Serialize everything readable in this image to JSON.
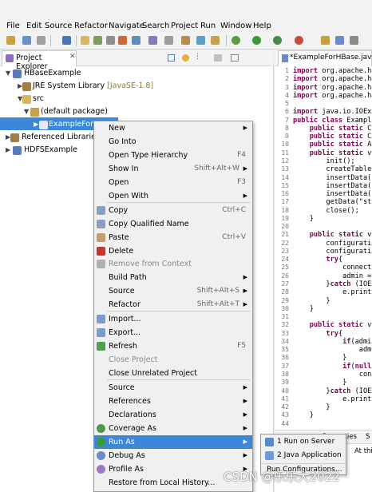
{
  "menubar": {
    "items": [
      "File",
      "Edit",
      "Source",
      "Refactor",
      "Navigate",
      "Search",
      "Project",
      "Run",
      "Window",
      "Help"
    ]
  },
  "explorer": {
    "tab_label": "Project Explorer",
    "tree": [
      {
        "label": "HBaseExample",
        "suffix": ""
      },
      {
        "label": "JRE System Library",
        "suffix": "[JavaSE-1.8]"
      },
      {
        "label": "src",
        "suffix": ""
      },
      {
        "label": "(default package)",
        "suffix": ""
      },
      {
        "label": "ExampleForHB",
        "suffix": ""
      },
      {
        "label": "Referenced Libraries",
        "suffix": ""
      },
      {
        "label": "HDFSExample",
        "suffix": ""
      }
    ]
  },
  "editor": {
    "tab_label": "*ExampleForHBase.java",
    "line_numbers": [
      "1",
      "2",
      "3",
      "4",
      "5",
      "6",
      "7",
      "8",
      "9",
      "10",
      "11",
      "12",
      "13",
      "14",
      "15",
      "16",
      "17",
      "18",
      "19",
      "20",
      "21",
      "22",
      "23",
      "24",
      "25",
      "26",
      "27",
      "28",
      "29",
      "30",
      "31",
      "32",
      "33",
      "34",
      "35",
      "36",
      "37",
      "38",
      "39",
      "40",
      "41",
      "42",
      "43",
      "44"
    ],
    "lines": [
      "import org.apache.had",
      "import org.apache.had",
      "import org.apache.had",
      "import org.apache.had",
      "",
      "import java.io.IOExce",
      "public class ExampleF",
      "    public static Con",
      "    public static Con",
      "    public static Adm",
      "    public static voi",
      "        init();",
      "        createTable(\"",
      "        insertData(\"s",
      "        insertData(\"s",
      "        insertData(\"s",
      "        getData(\"stud",
      "        close();",
      "    }",
      "",
      "    public static voi",
      "        configuration",
      "        configuration",
      "        try{",
      "            connectio",
      "            admin = c",
      "        }catch (IOExc",
      "            e.printSt",
      "        }",
      "    }",
      "",
      "    public static voi",
      "        try{",
      "            if(admin",
      "                admi",
      "            }",
      "            if(null !",
      "                conne",
      "            }",
      "        }catch (IOExc",
      "            e.printSt",
      "        }",
      "    }",
      ""
    ],
    "console_tabs": [
      "Properties",
      "S"
    ],
    "console_text": "At this ti"
  },
  "context_menu": {
    "items": [
      {
        "label": "New",
        "shortcut": "",
        "submenu": true,
        "disabled": false
      },
      {
        "label": "Go Into",
        "shortcut": "",
        "submenu": false,
        "disabled": false
      },
      {
        "label": "Open Type Hierarchy",
        "shortcut": "F4",
        "submenu": false,
        "disabled": false
      },
      {
        "label": "Show In",
        "shortcut": "Shift+Alt+W",
        "submenu": true,
        "disabled": false
      },
      {
        "label": "Open",
        "shortcut": "F3",
        "submenu": false,
        "disabled": false
      },
      {
        "label": "Open With",
        "shortcut": "",
        "submenu": true,
        "disabled": false
      },
      {
        "label": "Copy",
        "shortcut": "Ctrl+C",
        "submenu": false,
        "disabled": false
      },
      {
        "label": "Copy Qualified Name",
        "shortcut": "",
        "submenu": false,
        "disabled": false
      },
      {
        "label": "Paste",
        "shortcut": "Ctrl+V",
        "submenu": false,
        "disabled": false
      },
      {
        "label": "Delete",
        "shortcut": "",
        "submenu": false,
        "disabled": false
      },
      {
        "label": "Remove from Context",
        "shortcut": "",
        "submenu": false,
        "disabled": true
      },
      {
        "label": "Build Path",
        "shortcut": "",
        "submenu": true,
        "disabled": false
      },
      {
        "label": "Source",
        "shortcut": "Shift+Alt+S",
        "submenu": true,
        "disabled": false
      },
      {
        "label": "Refactor",
        "shortcut": "Shift+Alt+T",
        "submenu": true,
        "disabled": false
      },
      {
        "label": "Import...",
        "shortcut": "",
        "submenu": false,
        "disabled": false
      },
      {
        "label": "Export...",
        "shortcut": "",
        "submenu": false,
        "disabled": false
      },
      {
        "label": "Refresh",
        "shortcut": "F5",
        "submenu": false,
        "disabled": false
      },
      {
        "label": "Close Project",
        "shortcut": "",
        "submenu": false,
        "disabled": true
      },
      {
        "label": "Close Unrelated Project",
        "shortcut": "",
        "submenu": false,
        "disabled": false
      },
      {
        "label": "Source",
        "shortcut": "",
        "submenu": true,
        "disabled": false
      },
      {
        "label": "References",
        "shortcut": "",
        "submenu": true,
        "disabled": false
      },
      {
        "label": "Declarations",
        "shortcut": "",
        "submenu": true,
        "disabled": false
      },
      {
        "label": "Coverage As",
        "shortcut": "",
        "submenu": true,
        "disabled": false
      },
      {
        "label": "Run As",
        "shortcut": "",
        "submenu": true,
        "disabled": false
      },
      {
        "label": "Debug As",
        "shortcut": "",
        "submenu": true,
        "disabled": false
      },
      {
        "label": "Profile As",
        "shortcut": "",
        "submenu": true,
        "disabled": false
      },
      {
        "label": "Restore from Local History...",
        "shortcut": "",
        "submenu": false,
        "disabled": false
      }
    ]
  },
  "run_as_submenu": {
    "items": [
      "1 Run on Server",
      "2 Java Application",
      "Run Configurations..."
    ]
  },
  "watermark": "CSDN @乐乐大2022",
  "colors": {
    "selection": "#3b87d8",
    "keyword": "#7f0055",
    "string": "#2a00ff",
    "field": "#0000c0"
  }
}
